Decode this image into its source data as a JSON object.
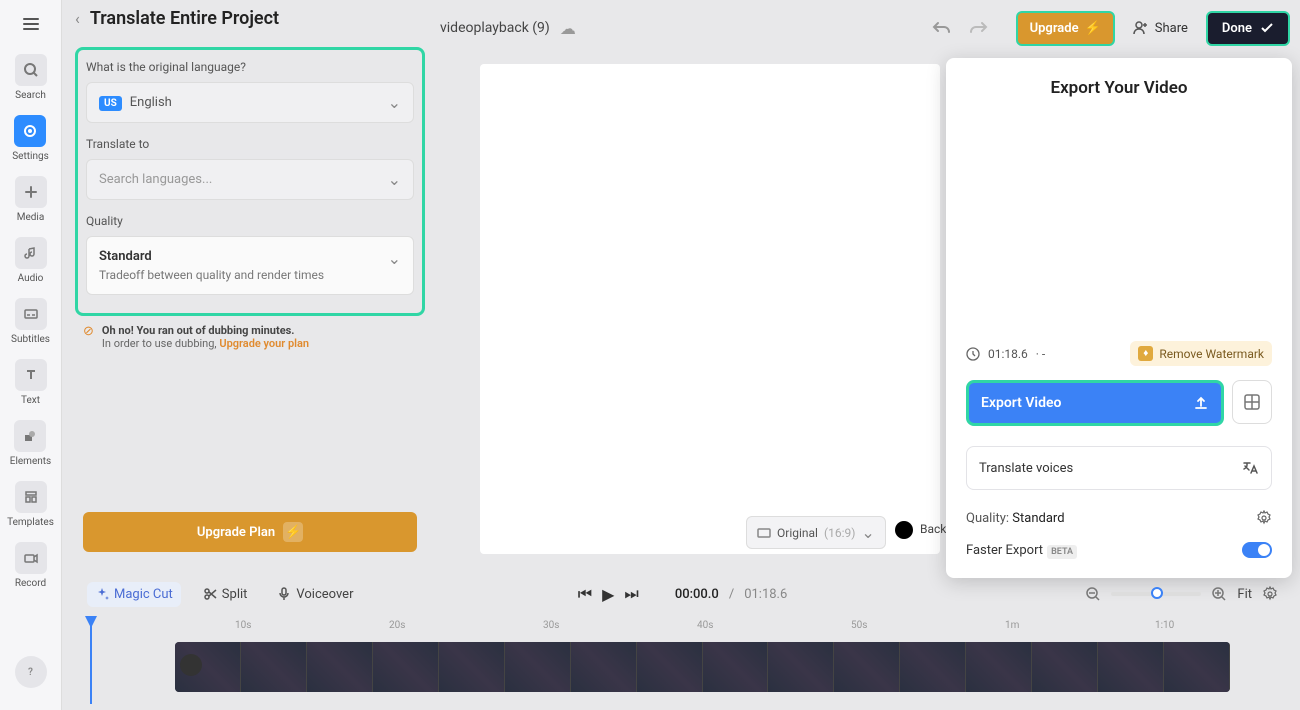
{
  "rail": {
    "items": [
      {
        "label": "Search"
      },
      {
        "label": "Settings"
      },
      {
        "label": "Media"
      },
      {
        "label": "Audio"
      },
      {
        "label": "Subtitles"
      },
      {
        "label": "Text"
      },
      {
        "label": "Elements"
      },
      {
        "label": "Templates"
      },
      {
        "label": "Record"
      }
    ]
  },
  "panel": {
    "title": "Translate Entire Project",
    "orig_label": "What is the original language?",
    "orig_flag": "US",
    "orig_lang": "English",
    "trans_label": "Translate to",
    "trans_placeholder": "Search languages...",
    "quality_label": "Quality",
    "quality_value": "Standard",
    "quality_sub": "Tradeoff between quality and render times",
    "warn_title": "Oh no! You ran out of dubbing minutes.",
    "warn_sub": "In order to use dubbing, ",
    "warn_link": "Upgrade your plan",
    "upgrade_plan": "Upgrade Plan"
  },
  "topbar": {
    "project": "videoplayback (9)",
    "upgrade": "Upgrade",
    "share": "Share",
    "done": "Done"
  },
  "aspect": {
    "label": "Original",
    "ratio": "(16:9)",
    "back": "Back"
  },
  "popover": {
    "title": "Export Your Video",
    "duration": "01:18.6",
    "dash": "· -",
    "remove_wm": "Remove Watermark",
    "export": "Export Video",
    "translate": "Translate voices",
    "quality_label": "Quality:",
    "quality_value": "Standard",
    "faster": "Faster Export",
    "beta": "BETA"
  },
  "toolbar": {
    "magic": "Magic Cut",
    "split": "Split",
    "voiceover": "Voiceover",
    "time_current": "00:00.0",
    "time_sep": "/",
    "time_total": "01:18.6",
    "fit": "Fit"
  },
  "ruler": [
    "10s",
    "20s",
    "30s",
    "40s",
    "50s",
    "1m",
    "1:10"
  ]
}
